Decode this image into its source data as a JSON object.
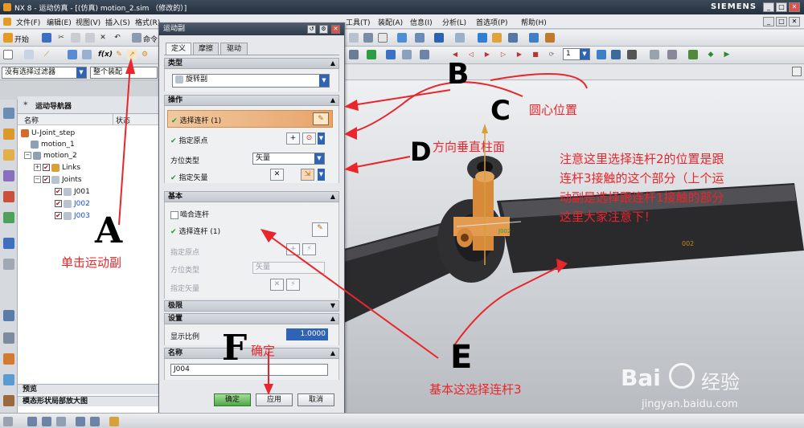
{
  "window": {
    "title": "NX 8 - 运动仿真 - [(仿真) motion_2.sim （修改的）]",
    "brand": "SIEMENS"
  },
  "menubar": {
    "items": [
      "文件(F)",
      "编辑(E)",
      "视图(V)",
      "插入(S)",
      "格式(R)",
      "工具(T)",
      "装配(A)",
      "信息(I)",
      "分析(L)",
      "首选项(P)",
      "帮助(H)"
    ]
  },
  "toolbar": {
    "start_label": "开始",
    "command_label": "命令"
  },
  "filter": {
    "selection_filter": "没有选择过滤器",
    "scope": "整个装配"
  },
  "navigator": {
    "title": "运动导航器",
    "col_name": "名称",
    "col_status": "状态",
    "nodes": [
      "U-Joint_step",
      "motion_1",
      "motion_2",
      "Links",
      "Joints",
      "J001",
      "J002",
      "J003"
    ],
    "bottom_preview": "预览",
    "bottom_enlarge": "模态形状局部放大图"
  },
  "dialog": {
    "title": "运动副",
    "tabs": [
      "定义",
      "摩擦",
      "驱动"
    ],
    "type_header": "类型",
    "type_value": "旋转副",
    "operation_header": "操作",
    "select_link": "选择连杆 (1)",
    "specify_origin": "指定原点",
    "orientation_type": "方位类型",
    "orientation_value": "矢量",
    "specify_vector": "指定矢量",
    "base_header": "基本",
    "engage_link": "啮合连杆",
    "base_select_link": "选择连杆 (1)",
    "base_origin": "指定原点",
    "base_orientation": "方位类型",
    "base_orientation_value": "矢量",
    "base_vector": "指定矢量",
    "limits_header": "极限",
    "settings_header": "设置",
    "display_scale_label": "显示比例",
    "display_scale_value": "1.0000",
    "name_header": "名称",
    "name_value": "J004",
    "ok_label": "确定",
    "apply_label": "应用",
    "cancel_label": "取消"
  },
  "viewport": {
    "label_joint": "J002",
    "label_small": "002"
  },
  "annotations": {
    "A": "A",
    "A_text": "单击运动副",
    "B": "B",
    "C": "C",
    "C_text": "圆心位置",
    "D": "D",
    "D_text": "方向垂直柱面",
    "E": "E",
    "E_text": "基本这选择连杆3",
    "F": "F",
    "F_text": "确定",
    "note_lines": [
      "注意这里选择连杆2的位置是跟",
      "连杆3接触的这个部分（上个运",
      "动副是选择跟连杆1接触的部分",
      "这里大家注意下！"
    ]
  },
  "watermark": {
    "brand": "Bai",
    "brand2": "经验",
    "url": "jingyan.baidu.com"
  },
  "colors": {
    "annotation_red": "#e8262c",
    "select_highlight": "#e8a46a",
    "dropdown_blue": "#2f63b5"
  }
}
